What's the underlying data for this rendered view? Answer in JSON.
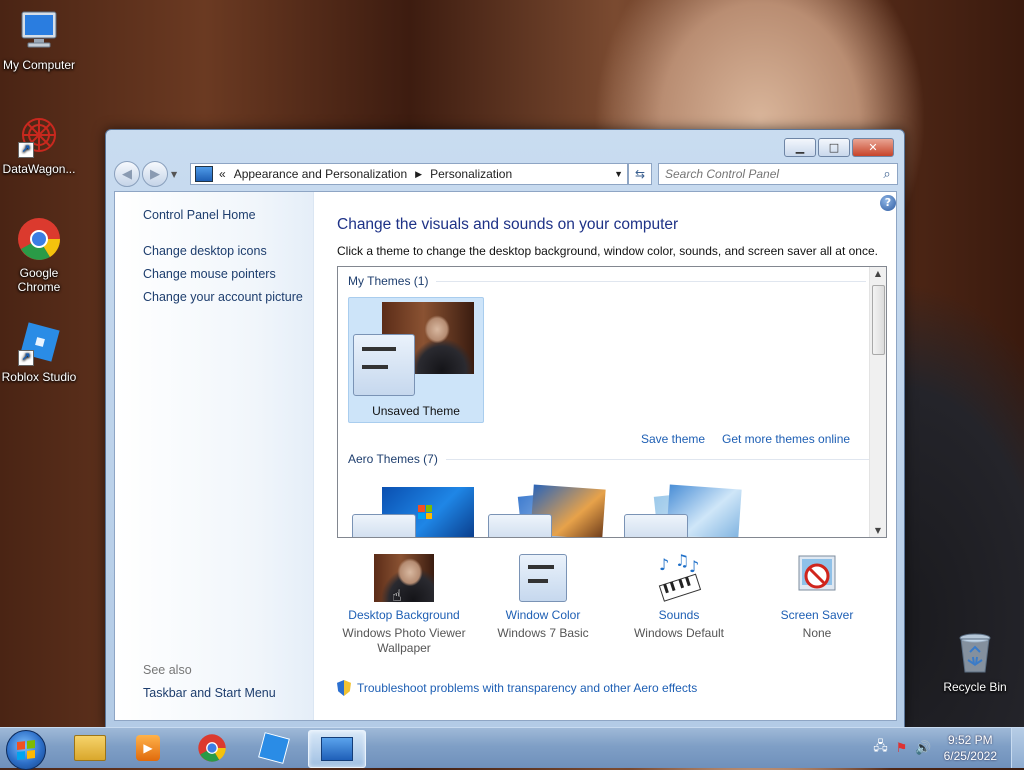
{
  "desktop": {
    "icons": [
      {
        "label": "My Computer"
      },
      {
        "label": "DataWagon..."
      },
      {
        "label": "Google Chrome"
      },
      {
        "label": "Roblox Studio"
      },
      {
        "label": "Recycle Bin"
      }
    ]
  },
  "window": {
    "address": {
      "overflow": "«",
      "crumbs": [
        "Appearance and Personalization",
        "Personalization"
      ]
    },
    "search": {
      "placeholder": "Search Control Panel"
    },
    "left_pane": {
      "home": "Control Panel Home",
      "links": [
        "Change desktop icons",
        "Change mouse pointers",
        "Change your account picture"
      ],
      "see_also": "See also",
      "see_also_links": [
        "Taskbar and Start Menu"
      ]
    },
    "main": {
      "title": "Change the visuals and sounds on your computer",
      "subtitle": "Click a theme to change the desktop background, window color, sounds, and screen saver all at once.",
      "my_themes": {
        "header": "My Themes (1)",
        "tiles": [
          {
            "label": "Unsaved Theme"
          }
        ]
      },
      "save_theme": "Save theme",
      "get_more": "Get more themes online",
      "aero_themes": {
        "header": "Aero Themes (7)"
      }
    },
    "bottom": [
      {
        "label": "Desktop Background",
        "value": "Windows Photo Viewer Wallpaper"
      },
      {
        "label": "Window Color",
        "value": "Windows 7 Basic"
      },
      {
        "label": "Sounds",
        "value": "Windows Default"
      },
      {
        "label": "Screen Saver",
        "value": "None"
      }
    ],
    "troubleshoot": "Troubleshoot problems with transparency and other Aero effects"
  },
  "taskbar": {
    "clock": {
      "time": "9:52 PM",
      "date": "6/25/2022"
    }
  },
  "colors": {
    "link": "#1e5fb4",
    "title": "#1e3287",
    "tile_selected": "#cde4f9"
  }
}
